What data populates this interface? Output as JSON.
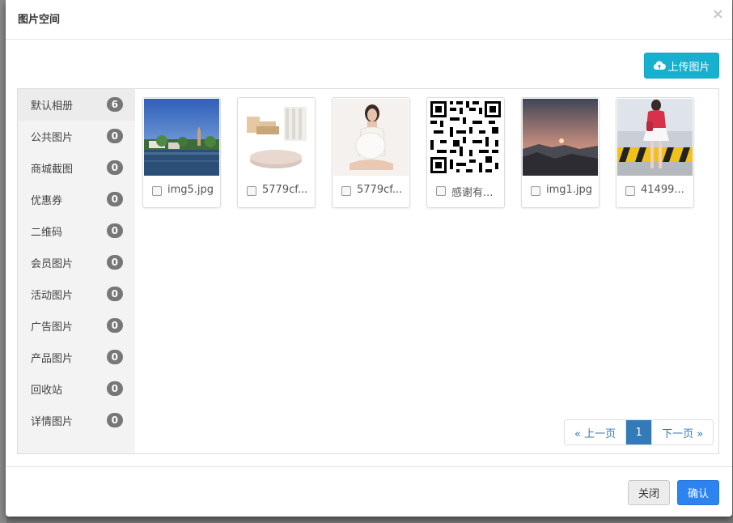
{
  "dialog": {
    "title": "图片空间",
    "close_symbol": "×",
    "upload_label": "上传图片",
    "upload_icon": "cloud-upload-icon"
  },
  "albums": [
    {
      "name": "默认相册",
      "count": "6"
    },
    {
      "name": "公共图片",
      "count": "0"
    },
    {
      "name": "商城截图",
      "count": "0"
    },
    {
      "name": "优惠券",
      "count": "0"
    },
    {
      "name": "二维码",
      "count": "0"
    },
    {
      "name": "会员图片",
      "count": "0"
    },
    {
      "name": "活动图片",
      "count": "0"
    },
    {
      "name": "广告图片",
      "count": "0"
    },
    {
      "name": "产品图片",
      "count": "0"
    },
    {
      "name": "回收站",
      "count": "0"
    },
    {
      "name": "详情图片",
      "count": "0"
    }
  ],
  "images": [
    {
      "name": "img5.jpg"
    },
    {
      "name": "5779cf..."
    },
    {
      "name": "5779cf..."
    },
    {
      "name": "感谢有..."
    },
    {
      "name": "img1.jpg"
    },
    {
      "name": "41499..."
    }
  ],
  "pagination": {
    "prev": "« 上一页",
    "current": "1",
    "next": "下一页 »"
  },
  "footer": {
    "close_label": "关闭",
    "confirm_label": "确认"
  },
  "colors": {
    "upload": "#17b0cf",
    "primary": "#2d83ef",
    "badge": "#777777"
  }
}
